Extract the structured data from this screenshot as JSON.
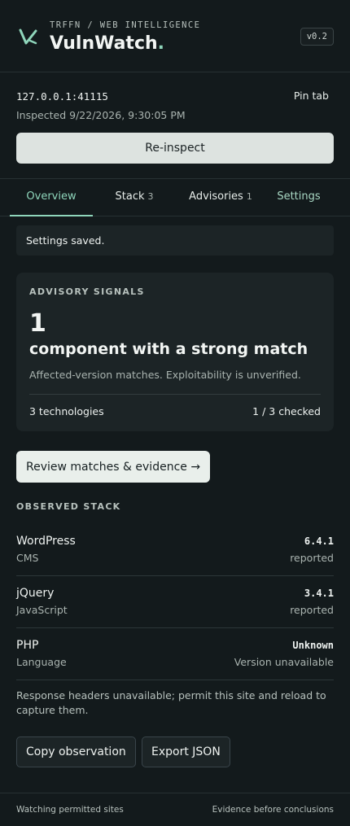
{
  "header": {
    "org": "TRFFN / WEB INTELLIGENCE",
    "title": "VulnWatch",
    "title_dot": ".",
    "version": "v0.2",
    "logo_icon": "v-check-logo",
    "accent": "#8fd6bb"
  },
  "target": {
    "host": "127.0.0.1:41115",
    "inspected": "Inspected 9/22/2026, 9:30:05 PM",
    "pin_label": "Pin tab",
    "reinspect_label": "Re-inspect"
  },
  "tabs": [
    {
      "label": "Overview",
      "count": "",
      "active": true
    },
    {
      "label": "Stack",
      "count": "3",
      "active": false
    },
    {
      "label": "Advisories",
      "count": "1",
      "active": false
    },
    {
      "label": "Settings",
      "count": "",
      "active": false
    }
  ],
  "notice": "Settings saved.",
  "signals": {
    "label": "ADVISORY SIGNALS",
    "count": "1",
    "headline": "component with a strong match",
    "description": "Affected-version matches. Exploitability is unverified.",
    "technologies": "3 technologies",
    "checked": "1 / 3 checked"
  },
  "review_label": "Review matches & evidence →",
  "stack": {
    "label": "OBSERVED STACK",
    "items": [
      {
        "name": "WordPress",
        "category": "CMS",
        "version": "6.4.1",
        "source": "reported"
      },
      {
        "name": "jQuery",
        "category": "JavaScript",
        "version": "3.4.1",
        "source": "reported"
      },
      {
        "name": "PHP",
        "category": "Language",
        "version": "Unknown",
        "source": "Version unavailable"
      }
    ],
    "headers_note": "Response headers unavailable; permit this site and reload to capture them."
  },
  "actions": {
    "copy_label": "Copy observation",
    "export_label": "Export JSON"
  },
  "footer": {
    "left": "Watching permitted sites",
    "right": "Evidence before conclusions"
  }
}
